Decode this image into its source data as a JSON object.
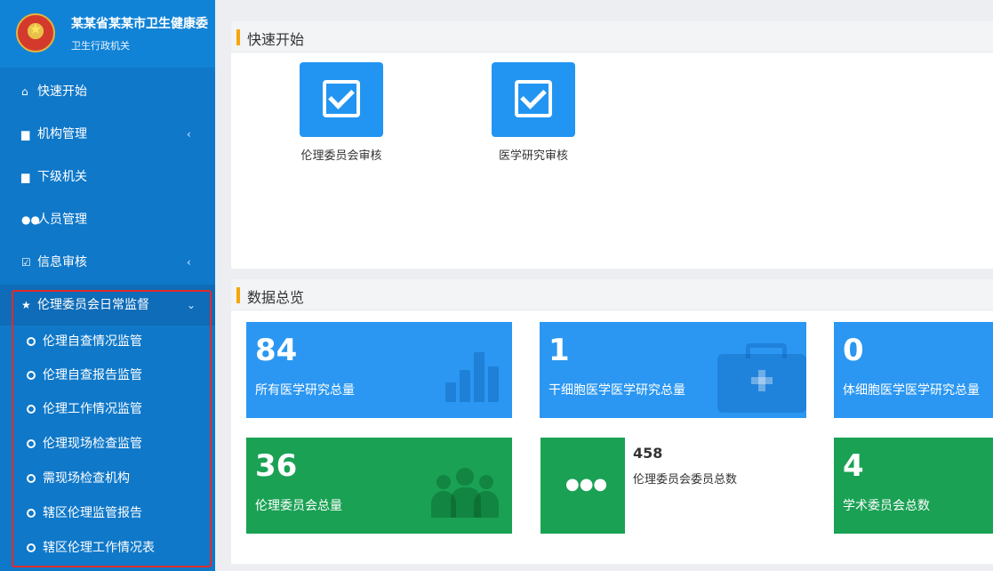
{
  "brand": {
    "title": "某某省某某市卫生健康委",
    "subtitle": "卫生行政机关"
  },
  "sidebar": {
    "items": [
      {
        "label": "快速开始",
        "icon": "home-icon"
      },
      {
        "label": "机构管理",
        "icon": "building-icon",
        "expandable": true
      },
      {
        "label": "下级机关",
        "icon": "building-icon"
      },
      {
        "label": "人员管理",
        "icon": "users-icon"
      },
      {
        "label": "信息审核",
        "icon": "check-square-icon",
        "expandable": true
      },
      {
        "label": "伦理委员会日常监督",
        "icon": "star-icon",
        "expanded": true
      }
    ],
    "subitems": [
      {
        "label": "伦理自查情况监管"
      },
      {
        "label": "伦理自查报告监管"
      },
      {
        "label": "伦理工作情况监管"
      },
      {
        "label": "伦理现场检查监管"
      },
      {
        "label": "需现场检查机构"
      },
      {
        "label": "辖区伦理监管报告"
      },
      {
        "label": "辖区伦理工作情况表"
      }
    ]
  },
  "quickstart": {
    "title": "快速开始",
    "tiles": [
      {
        "label": "伦理委员会审核",
        "icon": "check-square-icon"
      },
      {
        "label": "医学研究审核",
        "icon": "check-square-icon"
      }
    ]
  },
  "overview": {
    "title": "数据总览",
    "cards": [
      {
        "value": "84",
        "label": "所有医学研究总量",
        "color": "#2b97f2",
        "icon": "bar-chart-icon"
      },
      {
        "value": "1",
        "label": "干细胞医学医学研究总量",
        "color": "#2b97f2",
        "icon": "medkit-icon"
      },
      {
        "value": "0",
        "label": "体细胞医学医学研究总量",
        "color": "#2b97f2"
      },
      {
        "value": "36",
        "label": "伦理委员会总量",
        "color": "#1aa154",
        "icon": "users-icon"
      },
      {
        "value": "458",
        "label": "伦理委员会委员总数",
        "color": "#1aa154",
        "icon": "users-icon"
      },
      {
        "value": "4",
        "label": "学术委员会总数",
        "color": "#1aa154"
      }
    ]
  },
  "colors": {
    "sidebar_bg": "#0f78c9",
    "accent_orange": "#f6a60e",
    "highlight_red": "#e02b2b"
  }
}
